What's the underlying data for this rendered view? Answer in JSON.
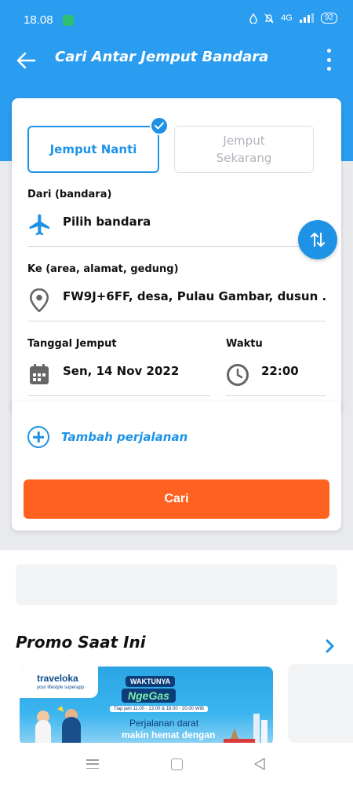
{
  "status_bar": {
    "time": "18.08",
    "network": "4G",
    "battery": "92"
  },
  "app_bar": {
    "title": "Cari Antar Jemput Bandara"
  },
  "tabs": [
    {
      "label": "Jemput Nanti",
      "active": true
    },
    {
      "label": "Jemput Sekarang",
      "active": false
    }
  ],
  "form": {
    "from_label": "Dari (bandara)",
    "from_value": "Pilih bandara",
    "to_label": "Ke (area, alamat, gedung)",
    "to_value": "FW9J+6FF, desa, Pulau Gambar, dusun ...",
    "date_label": "Tanggal Jemput",
    "date_value": "Sen, 14 Nov 2022",
    "time_label": "Waktu",
    "time_value": "22:00"
  },
  "add_trip_label": "Tambah perjalanan",
  "search_label": "Cari",
  "promo": {
    "title": "Promo Saat Ini",
    "card": {
      "logo": "traveloka",
      "logo_tagline": "your lifestyle superapp",
      "badge1": "WAKTUNYA",
      "badge2": "NgeGas",
      "hours": "Tiap jam 11.00 - 13.00 & 18.00 - 20.00 WIB",
      "line1": "Perjalanan darat",
      "line2": "makin hemat dengan"
    }
  },
  "colors": {
    "primary": "#2a9df0",
    "accent_blue": "#1e93e6",
    "cta_orange": "#ff6120"
  },
  "icons": [
    "back-arrow-icon",
    "more-vert-icon",
    "check-icon",
    "airplane-icon",
    "location-pin-icon",
    "calendar-icon",
    "clock-icon",
    "swap-icon",
    "add-circle-icon",
    "chevron-right-icon"
  ]
}
